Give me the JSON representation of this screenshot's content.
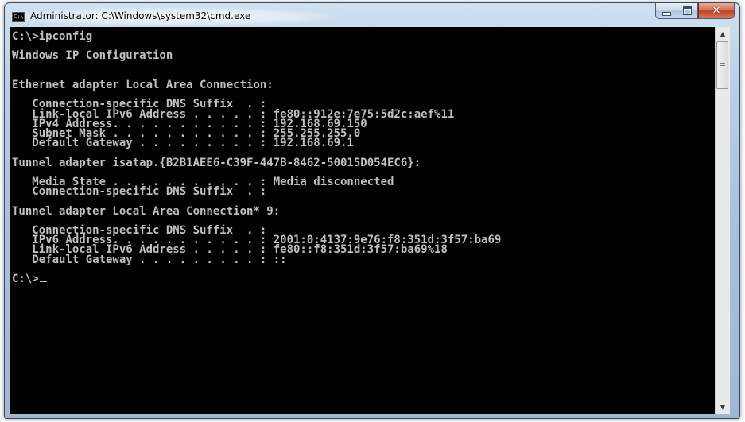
{
  "window": {
    "title": "Administrator: C:\\Windows\\system32\\cmd.exe",
    "icon": "cmd-app-icon",
    "icon_text": "C:\\",
    "buttons": {
      "minimize": "minimize-icon",
      "maximize": "maximize-icon",
      "close": "close-icon",
      "close_glyph": "✕"
    }
  },
  "console": {
    "background": "#000000",
    "foreground": "#c0c0c0",
    "lines": [
      "C:\\>ipconfig",
      "",
      "Windows IP Configuration",
      "",
      "",
      "Ethernet adapter Local Area Connection:",
      "",
      "   Connection-specific DNS Suffix  . :",
      "   Link-local IPv6 Address . . . . . : fe80::912e:7e75:5d2c:aef%11",
      "   IPv4 Address. . . . . . . . . . . : 192.168.69.150",
      "   Subnet Mask . . . . . . . . . . . : 255.255.255.0",
      "   Default Gateway . . . . . . . . . : 192.168.69.1",
      "",
      "Tunnel adapter isatap.{B2B1AEE6-C39F-447B-8462-50015D054EC6}:",
      "",
      "   Media State . . . . . . . . . . . : Media disconnected",
      "   Connection-specific DNS Suffix  . :",
      "",
      "Tunnel adapter Local Area Connection* 9:",
      "",
      "   Connection-specific DNS Suffix  . :",
      "   IPv6 Address. . . . . . . . . . . : 2001:0:4137:9e76:f8:351d:3f57:ba69",
      "   Link-local IPv6 Address . . . . . : fe80::f8:351d:3f57:ba69%18",
      "   Default Gateway . . . . . . . . . : ::",
      "",
      "C:\\>"
    ]
  },
  "scrollbar": {
    "up_arrow": "▲",
    "down_arrow": "▼",
    "thumb_position": 0.0
  }
}
